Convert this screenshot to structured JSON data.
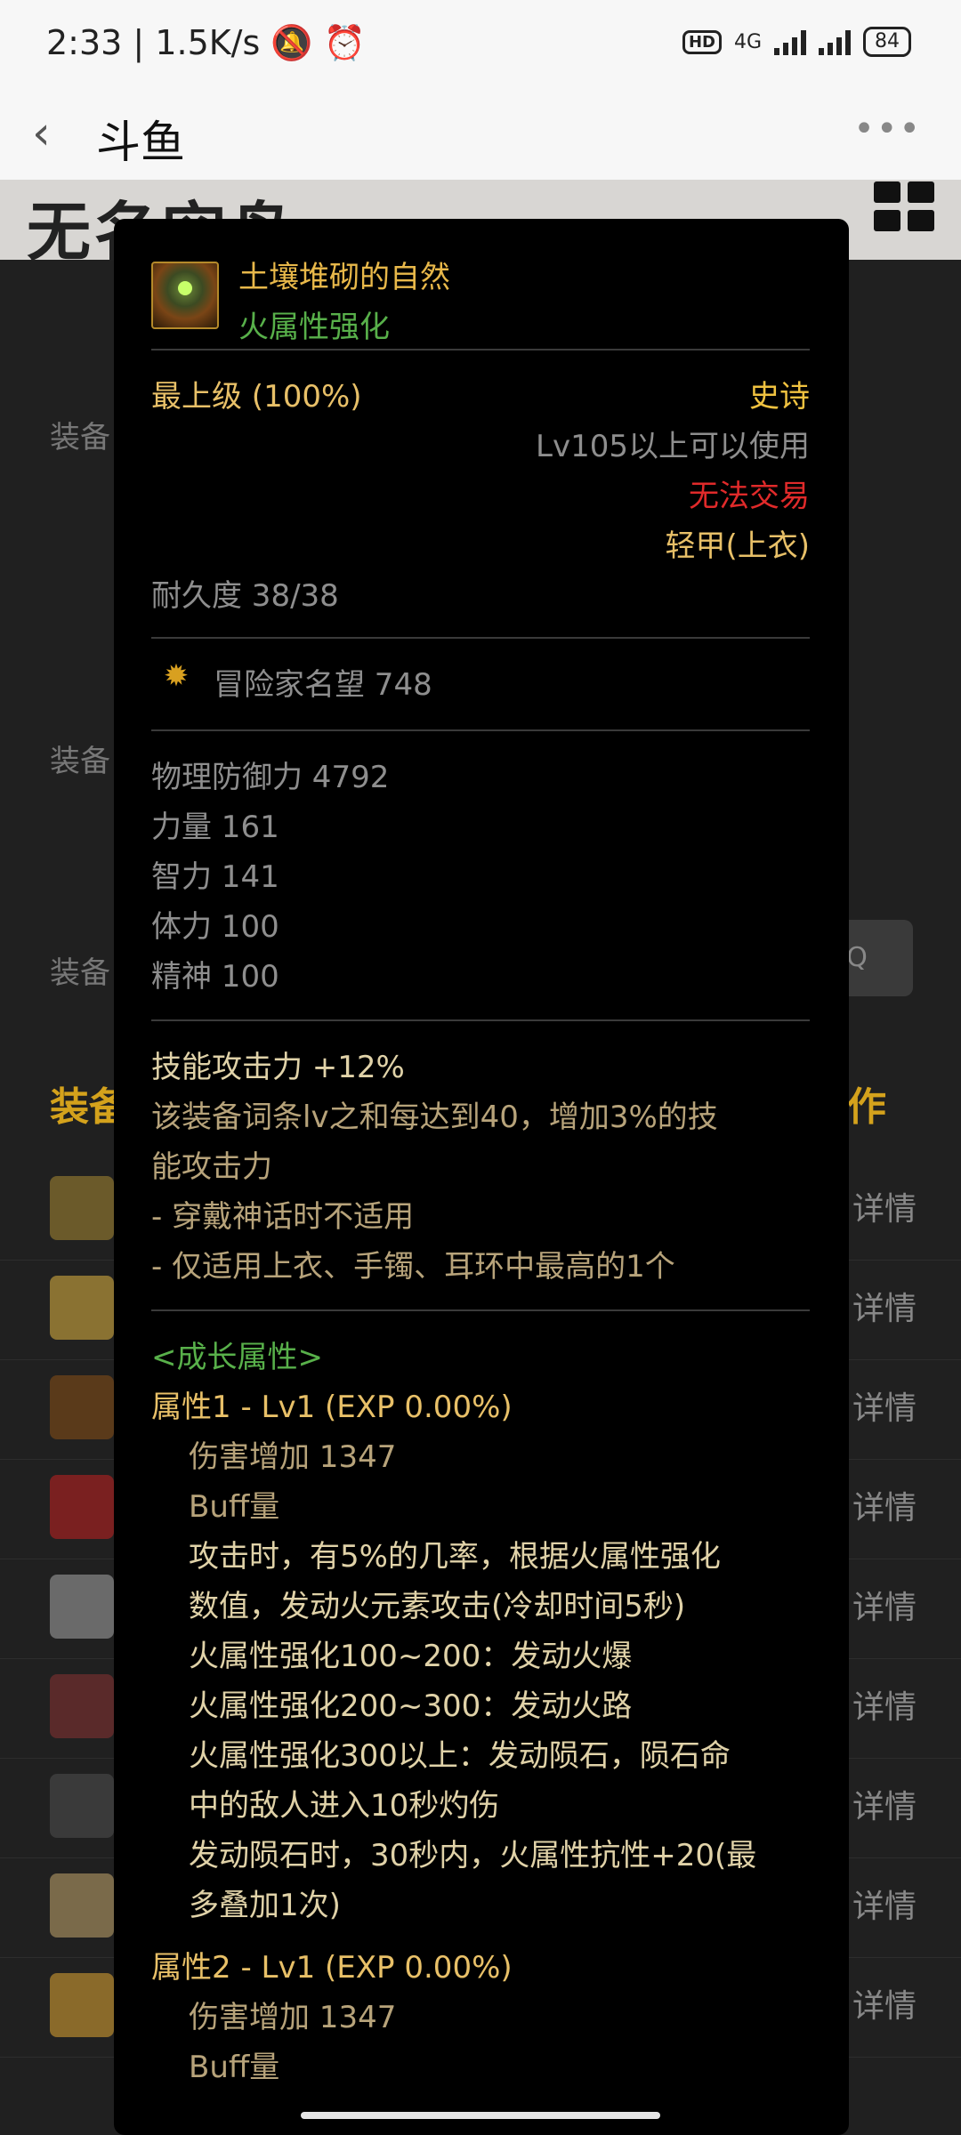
{
  "status_bar": {
    "time": "2:33",
    "net_speed": "1.5K/s",
    "hd": "HD",
    "network": "4G",
    "battery": "84"
  },
  "nav": {
    "title": "斗鱼",
    "back_glyph": "‹",
    "more_glyph": "•••"
  },
  "background": {
    "logo_text": "无名空岛",
    "labels": [
      "装备",
      "装备",
      "装备"
    ],
    "section_heading_left": "装备",
    "section_heading_right": "作",
    "row_detail": "详情",
    "search_glyph": "Q"
  },
  "tooltip": {
    "name": "土壤堆砌的自然",
    "subtitle": "火属性强化",
    "grade": "最上级 (100%)",
    "rarity": "史诗",
    "level_req": "Lv105以上可以使用",
    "trade": "无法交易",
    "slot": "轻甲(上衣)",
    "durability": "耐久度 38/38",
    "fame": "冒险家名望 748",
    "stats": [
      "物理防御力  4792",
      "力量  161",
      "智力  141",
      "体力  100",
      "精神  100"
    ],
    "skill_attack": "技能攻击力  +12%",
    "skill_desc": [
      "该装备词条lv之和每达到40，增加3%的技",
      "能攻击力",
      "- 穿戴神话时不适用",
      "- 仅适用上衣、手镯、耳环中最高的1个"
    ],
    "growth_header": "<成长属性>",
    "attr1_title": "属性1 - Lv1 (EXP 0.00%)",
    "attr1_lines": [
      "伤害增加  1347",
      "Buff量",
      "攻击时，有5%的几率，根据火属性强化",
      "数值，发动火元素攻击(冷却时间5秒)",
      "火属性强化100~200：发动火爆",
      "火属性强化200~300：发动火路",
      "火属性强化300以上：发动陨石，陨石命",
      "中的敌人进入10秒灼伤",
      "发动陨石时，30秒内，火属性抗性+20(最",
      "多叠加1次)"
    ],
    "attr2_title": "属性2 - Lv1 (EXP 0.00%)",
    "attr2_lines": [
      "伤害增加  1347",
      "Buff量"
    ]
  },
  "colors": {
    "gold": "#e8c068",
    "green": "#58b04a",
    "red": "#e02a2a",
    "grey": "#8e8e8e"
  }
}
